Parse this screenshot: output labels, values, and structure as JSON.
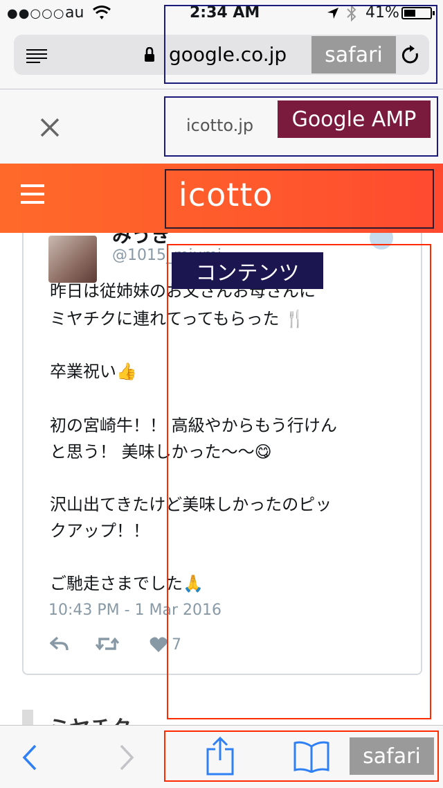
{
  "status_bar": {
    "carrier": "au",
    "time": "2:34 AM",
    "battery": "41%"
  },
  "url_bar": {
    "domain": "google.co.jp"
  },
  "amp_header": {
    "site": "icotto.jp"
  },
  "site_header": {
    "logo": "icotto"
  },
  "tweet": {
    "name": "みうき",
    "handle": "@1015_miumi",
    "lines": [
      "昨日は従姉妹のお父さんお母さんに",
      "ミヤチクに連れてってもらった 🍴",
      "卒業祝い👍",
      "初の宮崎牛！！ 高級やからもう行けん",
      "と思う！ 美味しかった〜〜😋",
      "沢山出てきたけど美味しかったのピッ",
      "クアップ！！",
      "ご馳走さまでした🙏"
    ],
    "timestamp": "10:43 PM - 1 Mar 2016",
    "like_count": "7"
  },
  "next_heading": "ミヤチク",
  "annotations": {
    "safari_top": "safari",
    "google_amp": "Google AMP",
    "contents": "コンテンツ",
    "safari_bottom": "safari"
  },
  "colors": {
    "header_orange": "#ff5a2c",
    "amp_label_bg": "#7a1a3c",
    "contents_label_bg": "#1c1650",
    "safari_label_bg": "#9a9a9a",
    "outline_navy": "#1a1a7a",
    "outline_red": "#ff2a00",
    "ios_blue": "#2f7ff5"
  }
}
